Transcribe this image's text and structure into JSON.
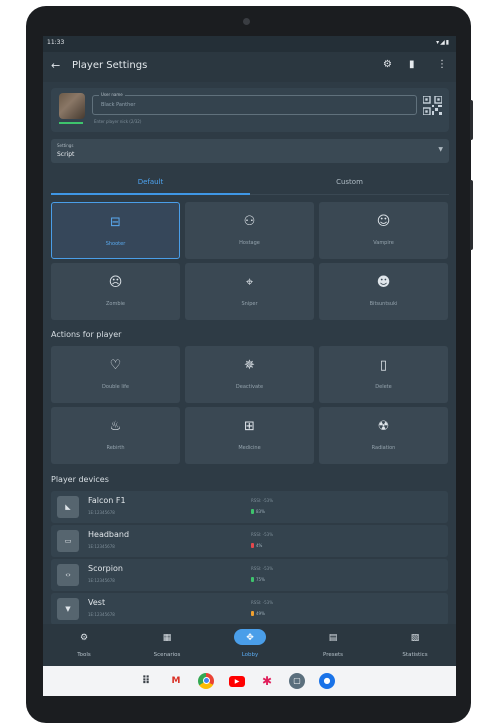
{
  "status": {
    "time": "11:33",
    "icons": "▾◢▮"
  },
  "appbar": {
    "title": "Player Settings",
    "back_icon": "arrow-left-icon",
    "actions": [
      "gear-icon",
      "trash-icon",
      "more-vert-icon"
    ]
  },
  "profile": {
    "nick_label": "User name",
    "nick_value": "Black Panther",
    "helper": "Enter player nick (2/32)"
  },
  "settings": {
    "label": "Settings",
    "value": "Script"
  },
  "tabs": [
    "Default",
    "Custom"
  ],
  "default_actions": [
    {
      "label": "Shooter",
      "icon": "shooter-icon",
      "selected": true
    },
    {
      "label": "Hostage",
      "icon": "hostage-icon",
      "selected": false
    },
    {
      "label": "Vampire",
      "icon": "vampire-icon",
      "selected": false
    },
    {
      "label": "Zombie",
      "icon": "zombie-icon",
      "selected": false
    },
    {
      "label": "Sniper",
      "icon": "crosshair-icon",
      "selected": false
    },
    {
      "label": "Bitsuntsuki",
      "icon": "mask-icon",
      "selected": false
    }
  ],
  "actions_title": "Actions for player",
  "player_actions": [
    {
      "label": "Double life",
      "icon": "heart-icon"
    },
    {
      "label": "Deactivate",
      "icon": "deactivate-icon"
    },
    {
      "label": "Delete",
      "icon": "trash-icon"
    },
    {
      "label": "Rebirth",
      "icon": "flame-icon"
    },
    {
      "label": "Medicine",
      "icon": "medkit-icon"
    },
    {
      "label": "Radiation",
      "icon": "radiation-icon"
    }
  ],
  "devices_title": "Player devices",
  "devices": [
    {
      "name": "Falcon F1",
      "id": "1E:12345678",
      "icon": "gun-icon",
      "rssi": "RSSI: -53%",
      "battery": "83%",
      "battery_color": "#3ec46d"
    },
    {
      "name": "Headband",
      "id": "1E:12345678",
      "icon": "headband-icon",
      "rssi": "RSSI: -53%",
      "battery": "4%",
      "battery_color": "#e5484d"
    },
    {
      "name": "Scorpion",
      "id": "1E:12345678",
      "icon": "code-icon",
      "rssi": "RSSI: -53%",
      "battery": "75%",
      "battery_color": "#3ec46d"
    },
    {
      "name": "Vest",
      "id": "1E:12345678",
      "icon": "vest-icon",
      "rssi": "RSSI: -53%",
      "battery": "49%",
      "battery_color": "#f0a030"
    }
  ],
  "bottom_nav": [
    {
      "label": "Tools",
      "icon": "gear-icon",
      "active": false
    },
    {
      "label": "Scenarios",
      "icon": "grid-icon",
      "active": false
    },
    {
      "label": "Lobby",
      "icon": "lobby-icon",
      "active": true
    },
    {
      "label": "Presets",
      "icon": "presets-icon",
      "active": false
    },
    {
      "label": "Statistics",
      "icon": "chart-icon",
      "active": false
    }
  ],
  "dock": [
    "apps-icon",
    "gmail-icon",
    "chrome-icon",
    "youtube-icon",
    "slack-icon",
    "app-icon",
    "messages-icon"
  ],
  "colors": {
    "accent": "#4a9ee9",
    "background": "#2e3b45",
    "tile": "#3a4853"
  }
}
